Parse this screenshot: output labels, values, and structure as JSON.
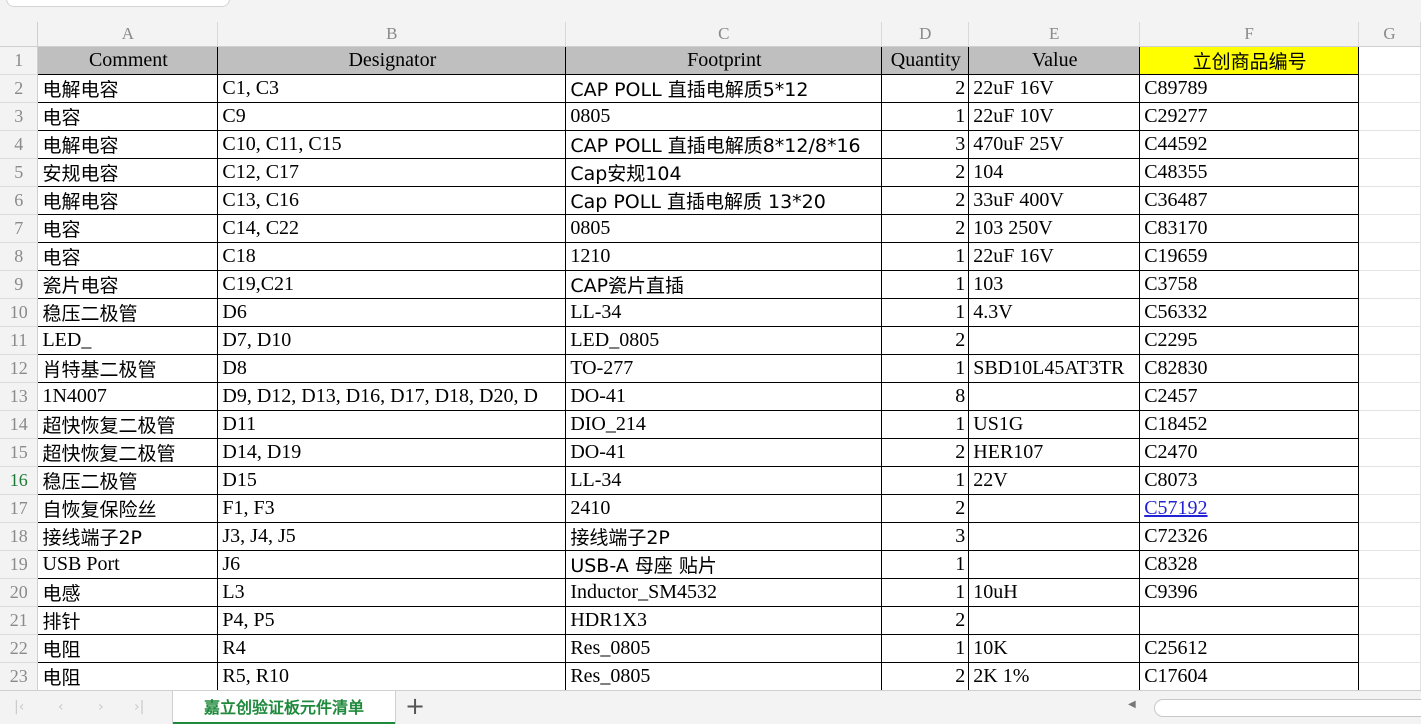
{
  "columns": [
    "A",
    "B",
    "C",
    "D",
    "E",
    "F",
    "G"
  ],
  "header_row": {
    "row_number": "1",
    "cells": [
      "Comment",
      "Designator",
      "Footprint",
      "Quantity",
      "Value",
      "立创商品编号"
    ]
  },
  "rows": [
    {
      "n": "2",
      "comment": "电解电容",
      "designator": "C1, C3",
      "footprint": "CAP POLL 直插电解质5*12",
      "quantity": "2",
      "value": "22uF 16V",
      "part": "C89789"
    },
    {
      "n": "3",
      "comment": "电容",
      "designator": "C9",
      "footprint": "0805",
      "quantity": "1",
      "value": "22uF 10V",
      "part": "C29277"
    },
    {
      "n": "4",
      "comment": "电解电容",
      "designator": "C10, C11, C15",
      "footprint": "CAP POLL 直插电解质8*12/8*16",
      "quantity": "3",
      "value": "470uF 25V",
      "part": "C44592"
    },
    {
      "n": "5",
      "comment": "安规电容",
      "designator": "C12, C17",
      "footprint": "Cap安规104",
      "quantity": "2",
      "value": "104",
      "part": "C48355"
    },
    {
      "n": "6",
      "comment": "电解电容",
      "designator": "C13, C16",
      "footprint": "Cap POLL 直插电解质 13*20",
      "quantity": "2",
      "value": "33uF 400V",
      "part": "C36487"
    },
    {
      "n": "7",
      "comment": "电容",
      "designator": "C14, C22",
      "footprint": "0805",
      "quantity": "2",
      "value": "103 250V",
      "part": "C83170"
    },
    {
      "n": "8",
      "comment": "电容",
      "designator": "C18",
      "footprint": "1210",
      "quantity": "1",
      "value": "22uF 16V",
      "part": "C19659"
    },
    {
      "n": "9",
      "comment": "瓷片电容",
      "designator": "C19,C21",
      "footprint": "CAP瓷片直插",
      "quantity": "1",
      "value": "103",
      "part": "C3758"
    },
    {
      "n": "10",
      "comment": "稳压二极管",
      "designator": "D6",
      "footprint": "LL-34",
      "quantity": "1",
      "value": "4.3V",
      "part": "C56332"
    },
    {
      "n": "11",
      "comment": "LED_",
      "designator": "D7, D10",
      "footprint": "LED_0805",
      "quantity": "2",
      "value": "",
      "part": "C2295"
    },
    {
      "n": "12",
      "comment": "肖特基二极管",
      "designator": "D8",
      "footprint": "TO-277",
      "quantity": "1",
      "value": "SBD10L45AT3TR",
      "part": "C82830"
    },
    {
      "n": "13",
      "comment": "1N4007",
      "designator": "D9, D12, D13, D16, D17, D18, D20, D",
      "footprint": "DO-41",
      "quantity": "8",
      "value": "",
      "part": "C2457"
    },
    {
      "n": "14",
      "comment": "超快恢复二极管",
      "designator": "D11",
      "footprint": "DIO_214",
      "quantity": "1",
      "value": "US1G",
      "part": "C18452"
    },
    {
      "n": "15",
      "comment": "超快恢复二极管",
      "designator": "D14, D19",
      "footprint": "DO-41",
      "quantity": "2",
      "value": "HER107",
      "part": "C2470"
    },
    {
      "n": "16",
      "comment": "稳压二极管",
      "designator": "D15",
      "footprint": "LL-34",
      "quantity": "1",
      "value": "22V",
      "part": "C8073"
    },
    {
      "n": "17",
      "comment": "自恢复保险丝",
      "designator": "F1, F3",
      "footprint": "2410",
      "quantity": "2",
      "value": "",
      "part": "C57192",
      "part_is_link": true
    },
    {
      "n": "18",
      "comment": "接线端子2P",
      "designator": "J3, J4, J5",
      "footprint": "接线端子2P",
      "quantity": "3",
      "value": "",
      "part": "C72326"
    },
    {
      "n": "19",
      "comment": "USB Port",
      "designator": "J6",
      "footprint": "USB-A 母座 贴片",
      "quantity": "1",
      "value": "",
      "part": "C8328"
    },
    {
      "n": "20",
      "comment": "电感",
      "designator": "L3",
      "footprint": "Inductor_SM4532",
      "quantity": "1",
      "value": "10uH",
      "part": "C9396"
    },
    {
      "n": "21",
      "comment": "排针",
      "designator": "P4, P5",
      "footprint": "HDR1X3",
      "quantity": "2",
      "value": "",
      "part": ""
    },
    {
      "n": "22",
      "comment": "电阻",
      "designator": "R4",
      "footprint": "Res_0805",
      "quantity": "1",
      "value": "10K",
      "part": "C25612"
    },
    {
      "n": "23",
      "comment": "电阻",
      "designator": "R5, R10",
      "footprint": "Res_0805",
      "quantity": "2",
      "value": "2K 1%",
      "part": "C17604"
    }
  ],
  "active_row": "16",
  "sheet_tab": {
    "label": "嘉立创验证板元件清单",
    "add_label": "+"
  },
  "nav": {
    "first": "|‹",
    "prev": "‹",
    "next": "›",
    "last": "›|"
  },
  "colors": {
    "header_gray": "#bfbfbf",
    "highlight_yellow": "#ffff00",
    "active_tab_green": "#1f8a3c",
    "link_blue": "#2323d6"
  }
}
